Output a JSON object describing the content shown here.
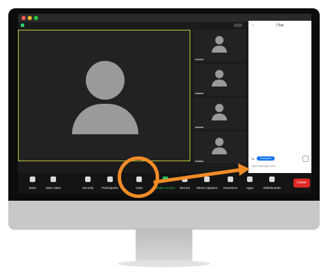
{
  "chat": {
    "title": "Chat",
    "to_label": "To:",
    "to_value": "Everyone",
    "placeholder": "Type message here..."
  },
  "toolbar": {
    "items": [
      {
        "label": "Mute",
        "icon": "microphone-icon"
      },
      {
        "label": "Start Video",
        "icon": "video-icon"
      },
      {
        "label": "Security",
        "icon": "shield-icon"
      },
      {
        "label": "Participants",
        "icon": "participants-icon"
      },
      {
        "label": "Chat",
        "icon": "chat-icon"
      },
      {
        "label": "Share Screen",
        "icon": "share-screen-icon"
      },
      {
        "label": "Record",
        "icon": "record-icon"
      },
      {
        "label": "Show Captions",
        "icon": "captions-icon"
      },
      {
        "label": "Reactions",
        "icon": "reactions-icon"
      },
      {
        "label": "Apps",
        "icon": "apps-icon"
      },
      {
        "label": "Whiteboards",
        "icon": "whiteboard-icon"
      }
    ],
    "leave_label": "Leave"
  },
  "accent": {
    "highlight": "#f28c28",
    "share": "#22c55e",
    "leave": "#e02828",
    "everyone_pill": "#0e71eb"
  }
}
